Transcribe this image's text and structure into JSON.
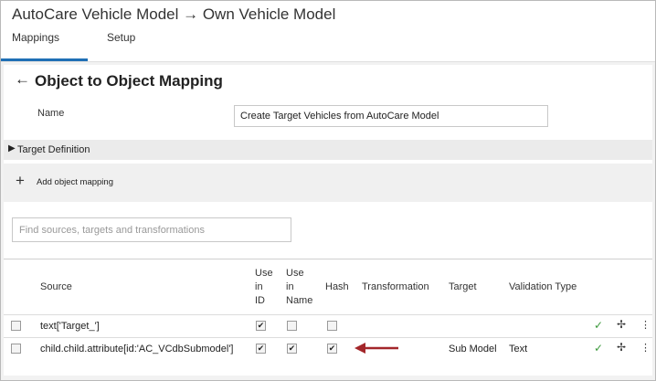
{
  "header": {
    "title": "AutoCare Vehicle Model → Own Vehicle Model",
    "tabs": [
      "Mappings",
      "Setup"
    ]
  },
  "page": {
    "title": "Object to Object Mapping",
    "name_label": "Name",
    "name_value": "Create Target Vehicles from AutoCare Model",
    "target_definition": "Target Definition",
    "add_object_mapping": "Add object mapping",
    "search_placeholder": "Find sources, targets and transformations"
  },
  "table": {
    "headers": {
      "source": "Source",
      "use_in_id": [
        "Use",
        "in",
        "ID"
      ],
      "use_in_name": [
        "Use",
        "in",
        "Name"
      ],
      "hash": "Hash",
      "transformation": "Transformation",
      "target": "Target",
      "validation_type": "Validation Type"
    },
    "rows": [
      {
        "source": "text['Target_']",
        "use_in_id": true,
        "use_in_name": false,
        "hash": false,
        "transformation": "",
        "target": "",
        "validation_type": ""
      },
      {
        "source": "child.child.attribute[id:'AC_VCdbSubmodel']",
        "use_in_id": true,
        "use_in_name": true,
        "hash": true,
        "transformation": "",
        "target": "Sub Model",
        "validation_type": "Text"
      }
    ]
  },
  "colors": {
    "accent": "#1f6fb5",
    "annotation_arrow": "#a3262a",
    "check": "#3d9a3d"
  },
  "icons": {
    "back": "back-arrow-icon",
    "expand": "triangle-right-icon",
    "add": "plus-icon",
    "confirm": "check-icon",
    "move": "move-icon",
    "more": "kebab-menu-icon"
  }
}
